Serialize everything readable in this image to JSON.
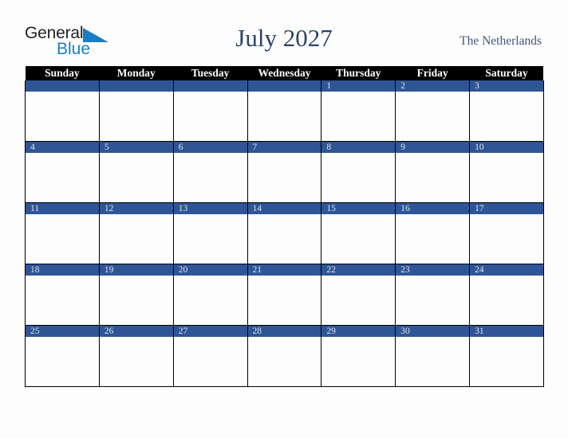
{
  "brand": {
    "logo_word_1": "General",
    "logo_word_2": "Blue",
    "triangle_color": "#1a7dc4",
    "word_1_color": "#231f20"
  },
  "header": {
    "title": "July 2027",
    "region": "The Netherlands",
    "title_color": "#2b4469",
    "region_color": "#41577d"
  },
  "calendar": {
    "month": "July",
    "year": "2027",
    "accent_color": "#2f5596",
    "header_bg": "#000000",
    "header_text_color": "#ffffff",
    "weekdays": [
      "Sunday",
      "Monday",
      "Tuesday",
      "Wednesday",
      "Thursday",
      "Friday",
      "Saturday"
    ],
    "weeks": [
      [
        {
          "day": ""
        },
        {
          "day": ""
        },
        {
          "day": ""
        },
        {
          "day": ""
        },
        {
          "day": "1"
        },
        {
          "day": "2"
        },
        {
          "day": "3"
        }
      ],
      [
        {
          "day": "4"
        },
        {
          "day": "5"
        },
        {
          "day": "6"
        },
        {
          "day": "7"
        },
        {
          "day": "8"
        },
        {
          "day": "9"
        },
        {
          "day": "10"
        }
      ],
      [
        {
          "day": "11"
        },
        {
          "day": "12"
        },
        {
          "day": "13"
        },
        {
          "day": "14"
        },
        {
          "day": "15"
        },
        {
          "day": "16"
        },
        {
          "day": "17"
        }
      ],
      [
        {
          "day": "18"
        },
        {
          "day": "19"
        },
        {
          "day": "20"
        },
        {
          "day": "21"
        },
        {
          "day": "22"
        },
        {
          "day": "23"
        },
        {
          "day": "24"
        }
      ],
      [
        {
          "day": "25"
        },
        {
          "day": "26"
        },
        {
          "day": "27"
        },
        {
          "day": "28"
        },
        {
          "day": "29"
        },
        {
          "day": "30"
        },
        {
          "day": "31"
        }
      ]
    ]
  }
}
